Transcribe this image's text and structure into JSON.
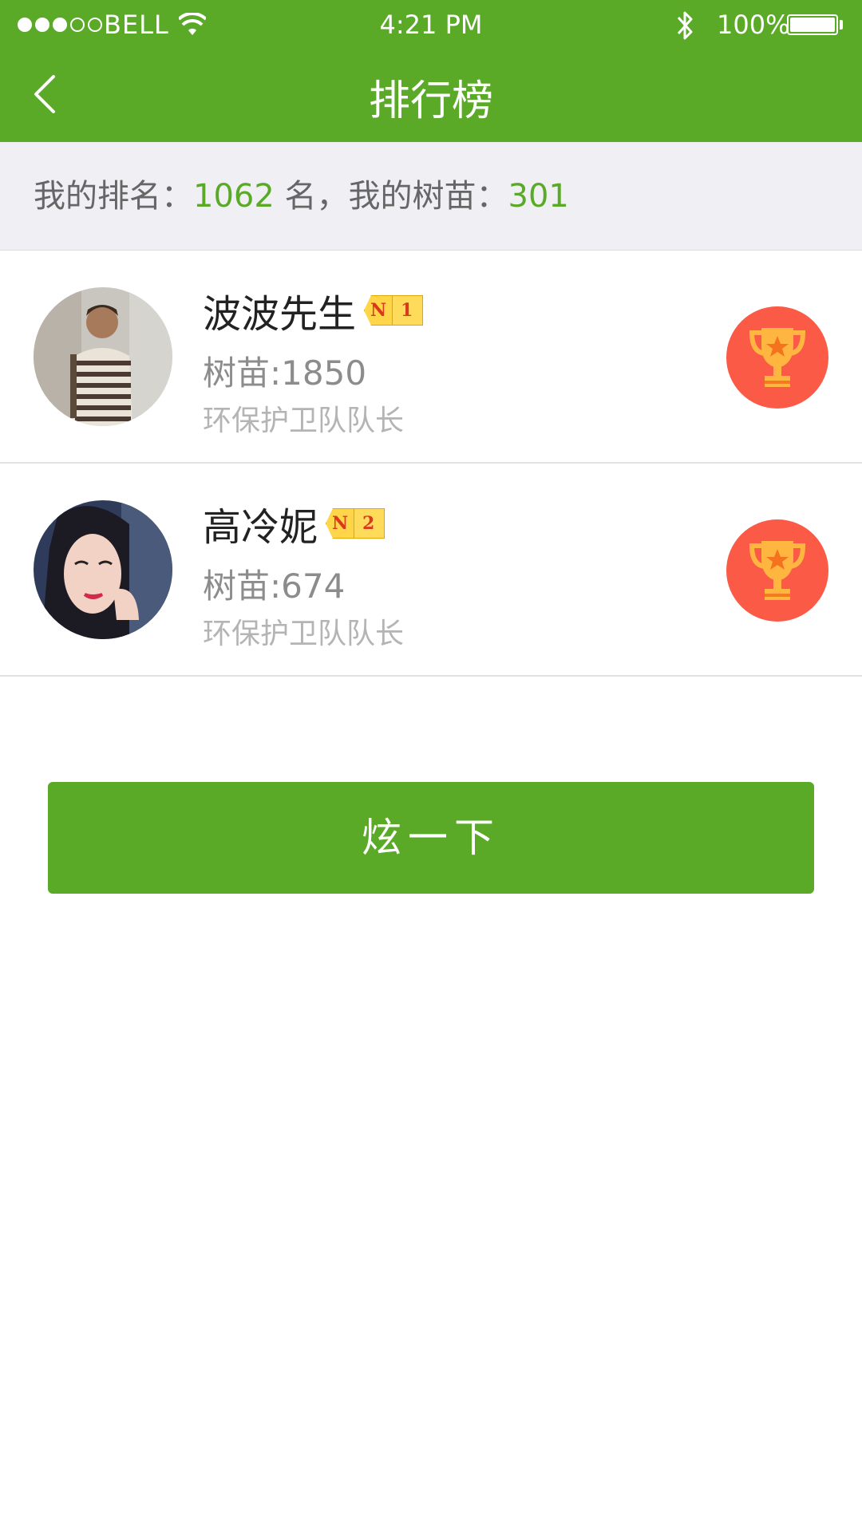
{
  "status_bar": {
    "carrier": "BELL",
    "time": "4:21 PM",
    "battery": "100%",
    "signal_strength": 3
  },
  "nav": {
    "title": "排行榜",
    "back_icon": "chevron-left-icon"
  },
  "summary": {
    "rank_label": "我的排名：",
    "rank_value": "1062",
    "rank_suffix": " 名，",
    "seedling_label": "我的树苗：",
    "seedling_value": "301"
  },
  "leaderboard": [
    {
      "name": "波波先生",
      "badge_letter": "N",
      "badge_rank": "1",
      "score": "树苗:1850",
      "title": "环保护卫队队长",
      "icon": "trophy-icon"
    },
    {
      "name": "高冷妮",
      "badge_letter": "N",
      "badge_rank": "2",
      "score": "树苗:674",
      "title": "环保护卫队队长",
      "icon": "trophy-icon"
    }
  ],
  "cta": {
    "label": "炫一下"
  },
  "colors": {
    "brand_green": "#5aaa28",
    "trophy_red": "#fa5a46",
    "badge_yellow": "#ffd54a"
  }
}
